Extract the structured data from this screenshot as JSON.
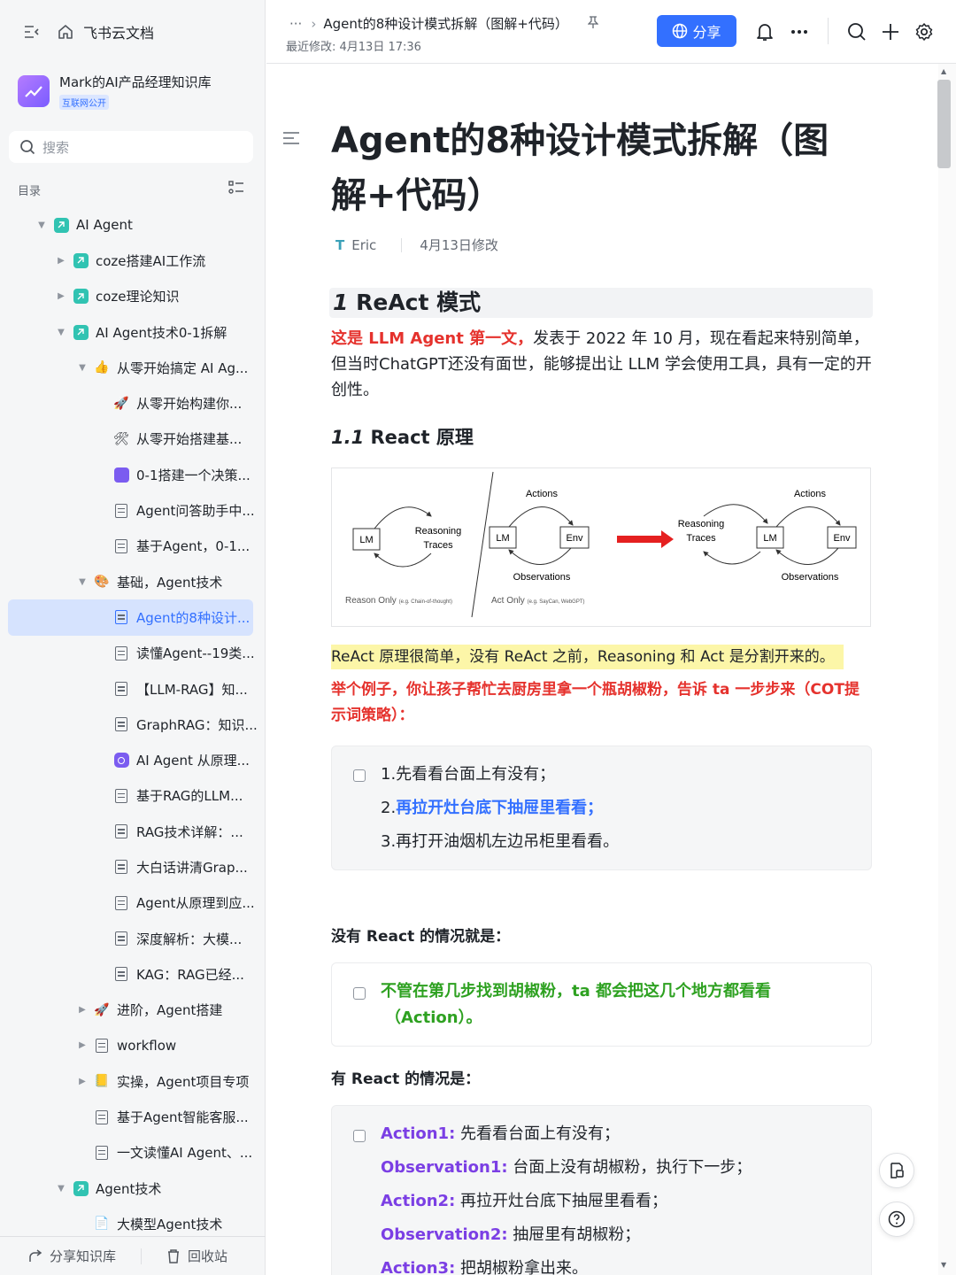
{
  "app": {
    "name": "飞书云文档"
  },
  "knowledge_base": {
    "title": "Mark的AI产品经理知识库",
    "badge": "互联网公开"
  },
  "search": {
    "placeholder": "搜索"
  },
  "toc": {
    "label": "目录"
  },
  "tree": [
    {
      "label": "AI Agent",
      "depth": 0,
      "arrow": "▼",
      "icon": "square-icon"
    },
    {
      "label": "coze搭建AI工作流",
      "depth": 1,
      "arrow": "▶",
      "icon": "square-icon"
    },
    {
      "label": "coze理论知识",
      "depth": 1,
      "arrow": "▶",
      "icon": "square-icon"
    },
    {
      "label": "AI Agent技术0-1拆解",
      "depth": 1,
      "arrow": "▼",
      "icon": "square-icon"
    },
    {
      "label": "从零开始搞定 AI Ag...",
      "depth": 2,
      "arrow": "▼",
      "icon": "emoji-icon",
      "emoji": "👍"
    },
    {
      "label": "从零开始构建你...",
      "depth": 3,
      "arrow": "",
      "icon": "emoji-icon",
      "emoji": "🚀"
    },
    {
      "label": "从零开始搭建基...",
      "depth": 3,
      "arrow": "",
      "icon": "emoji-icon",
      "emoji": "🛠"
    },
    {
      "label": "0-1搭建一个决策...",
      "depth": 3,
      "arrow": "",
      "icon": "purple-square-icon"
    },
    {
      "label": "Agent问答助手中...",
      "depth": 3,
      "arrow": "",
      "icon": "doc-icon"
    },
    {
      "label": "基于Agent，0-1...",
      "depth": 3,
      "arrow": "",
      "icon": "doc-icon"
    },
    {
      "label": "基础，Agent技术",
      "depth": 2,
      "arrow": "▼",
      "icon": "emoji-icon",
      "emoji": "🎨"
    },
    {
      "label": "Agent的8种设计...",
      "depth": 3,
      "arrow": "",
      "icon": "doc-icon-blue",
      "active": true
    },
    {
      "label": "读懂Agent--19类...",
      "depth": 3,
      "arrow": "",
      "icon": "doc-icon"
    },
    {
      "label": "【LLM-RAG】知...",
      "depth": 3,
      "arrow": "",
      "icon": "doc-icon"
    },
    {
      "label": "GraphRAG：知识...",
      "depth": 3,
      "arrow": "",
      "icon": "doc-icon"
    },
    {
      "label": "AI Agent 从原理...",
      "depth": 3,
      "arrow": "",
      "icon": "purple-circle-icon"
    },
    {
      "label": "基于RAG的LLM...",
      "depth": 3,
      "arrow": "",
      "icon": "doc-icon"
    },
    {
      "label": "RAG技术详解：...",
      "depth": 3,
      "arrow": "",
      "icon": "doc-icon"
    },
    {
      "label": "大白话讲清Grap...",
      "depth": 3,
      "arrow": "",
      "icon": "doc-icon"
    },
    {
      "label": "Agent从原理到应...",
      "depth": 3,
      "arrow": "",
      "icon": "doc-icon"
    },
    {
      "label": "深度解析：大模...",
      "depth": 3,
      "arrow": "",
      "icon": "doc-icon"
    },
    {
      "label": "KAG：RAG已经...",
      "depth": 3,
      "arrow": "",
      "icon": "doc-icon"
    },
    {
      "label": "进阶，Agent搭建",
      "depth": 2,
      "arrow": "▶",
      "icon": "emoji-icon",
      "emoji": "🚀"
    },
    {
      "label": "workflow",
      "depth": 2,
      "arrow": "▶",
      "icon": "doc-icon"
    },
    {
      "label": "实操，Agent项目专项",
      "depth": 2,
      "arrow": "▶",
      "icon": "emoji-icon",
      "emoji": "📒"
    },
    {
      "label": "基于Agent智能客服...",
      "depth": 2,
      "arrow": "",
      "icon": "doc-icon"
    },
    {
      "label": "一文读懂AI Agent、...",
      "depth": 2,
      "arrow": "",
      "icon": "doc-icon"
    },
    {
      "label": "Agent技术",
      "depth": 1,
      "arrow": "▼",
      "icon": "square-icon"
    },
    {
      "label": "大模型Agent技术",
      "depth": 2,
      "arrow": "",
      "icon": "emoji-icon",
      "emoji": "📄"
    }
  ],
  "sidebar_footer": {
    "share": "分享知识库",
    "trash": "回收站"
  },
  "header": {
    "dots": "···",
    "doc_title": "Agent的8种设计模式拆解（图解+代码）",
    "last_modified": "最近修改: 4月13日 17:36",
    "share_label": "分享"
  },
  "doc": {
    "title": "Agent的8种设计模式拆解（图解+代码）",
    "author": "Eric",
    "modified": "4月13日修改",
    "s1_num": "1",
    "s1_title": "ReAct 模式",
    "p1_red": "这是 LLM Agent 第一文，",
    "p1_rest": "发表于 2022 年 10 月，现在看起来特别简单，但当时ChatGPT还没有面世，能够提出让 LLM 学会使用工具，具有一定的开创性。",
    "s11_num": "1.1",
    "s11_title": "React 原理",
    "diagram": {
      "lm": "LM",
      "env": "Env",
      "actions": "Actions",
      "observations": "Observations",
      "reasoning_1": "Reasoning",
      "reasoning_2": "Traces",
      "reason_only": "Reason Only",
      "reason_only_note": "(e.g. Chain-of-thought)",
      "act_only": "Act Only",
      "act_only_note": "(e.g. SayCan, WebGPT)"
    },
    "highlight": "ReAct 原理很简单，没有 ReAct 之前，Reasoning 和 Act 是分割开来的。",
    "example": "举个例子，你让孩子帮忙去厨房里拿一个瓶胡椒粉，告诉 ta 一步步来（COT提示词策略）：",
    "steps": {
      "s1": "1.先看看台面上有没有；",
      "s2_num": "2.",
      "s2": "再拉开灶台底下抽屉里看看；",
      "s3": "3.再打开油烟机左边吊柜里看看。"
    },
    "no_react_heading": "没有 React 的情况就是：",
    "no_react_1": "不管在第几步找到胡椒粉，ta 都会把这几个地方都看看",
    "no_react_2": "（Action）。",
    "with_react_heading": "有 React 的情况是：",
    "react_lines": [
      {
        "key": "Action1:",
        "text": " 先看看台面上有没有；"
      },
      {
        "key": "Observation1:",
        "text": " 台面上没有胡椒粉，执行下一步；"
      },
      {
        "key": "Action2:",
        "text": " 再拉开灶台底下抽屉里看看；"
      },
      {
        "key": "Observation2:",
        "text": " 抽屉里有胡椒粉；"
      },
      {
        "key": "Action3:",
        "text": " 把胡椒粉拿出来。"
      }
    ]
  }
}
